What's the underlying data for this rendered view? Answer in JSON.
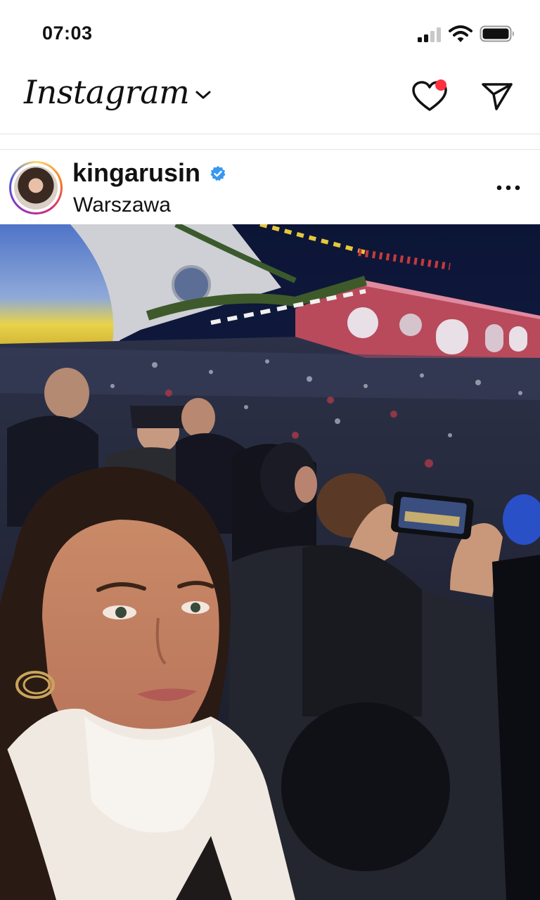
{
  "status_bar": {
    "time": "07:03",
    "icons": [
      "signal-icon",
      "wifi-icon",
      "battery-icon"
    ]
  },
  "header": {
    "logo_text": "Instagram",
    "icons": [
      "chevron-down-icon",
      "heart-icon",
      "send-icon"
    ],
    "has_notification": true
  },
  "post": {
    "username": "kingarusin",
    "verified": true,
    "location": "Warszawa",
    "icons": [
      "verified-icon",
      "more-icon"
    ]
  },
  "colors": {
    "notification": "#ff3040",
    "verified": "#3897f0",
    "divider": "#e3e3e3"
  }
}
